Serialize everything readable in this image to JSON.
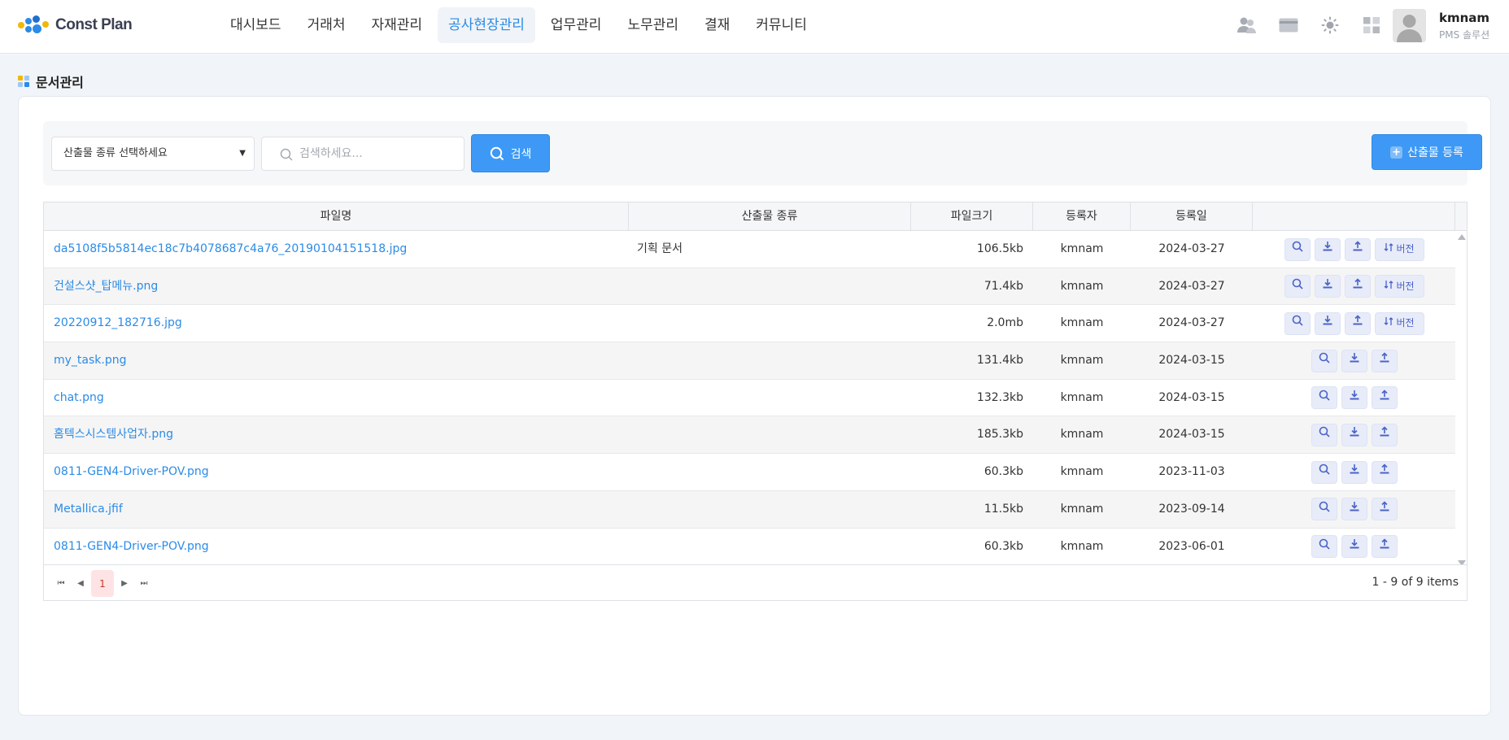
{
  "app": {
    "name": "Const Plan"
  },
  "nav": [
    {
      "label": "대시보드",
      "active": false
    },
    {
      "label": "거래처",
      "active": false
    },
    {
      "label": "자재관리",
      "active": false
    },
    {
      "label": "공사현장관리",
      "active": true
    },
    {
      "label": "업무관리",
      "active": false
    },
    {
      "label": "노무관리",
      "active": false
    },
    {
      "label": "결재",
      "active": false
    },
    {
      "label": "커뮤니티",
      "active": false
    }
  ],
  "header_icons": [
    "users-icon",
    "card-icon",
    "sun-icon",
    "grid-icon"
  ],
  "user": {
    "name": "kmnam",
    "org": "PMS 솔루션"
  },
  "page": {
    "title": "문서관리"
  },
  "filter": {
    "type_placeholder": "산출물 종류 선택하세요",
    "search_placeholder": "검색하세요...",
    "search_label": "검색",
    "register_label": "산출물 등록"
  },
  "table": {
    "columns": [
      "파일명",
      "산출물 종류",
      "파일크기",
      "등록자",
      "등록일",
      ""
    ],
    "version_label": "버전",
    "rows": [
      {
        "name": "da5108f5b5814ec18c7b4078687c4a76_20190104151518.jpg",
        "type": "기획 문서",
        "size": "106.5kb",
        "user": "kmnam",
        "date": "2024-03-27",
        "version": true
      },
      {
        "name": "건설스샷_탑메뉴.png",
        "type": "",
        "size": "71.4kb",
        "user": "kmnam",
        "date": "2024-03-27",
        "version": true
      },
      {
        "name": "20220912_182716.jpg",
        "type": "",
        "size": "2.0mb",
        "user": "kmnam",
        "date": "2024-03-27",
        "version": true
      },
      {
        "name": "my_task.png",
        "type": "",
        "size": "131.4kb",
        "user": "kmnam",
        "date": "2024-03-15",
        "version": false
      },
      {
        "name": "chat.png",
        "type": "",
        "size": "132.3kb",
        "user": "kmnam",
        "date": "2024-03-15",
        "version": false
      },
      {
        "name": "홈텍스시스템사업자.png",
        "type": "",
        "size": "185.3kb",
        "user": "kmnam",
        "date": "2024-03-15",
        "version": false
      },
      {
        "name": "0811-GEN4-Driver-POV.png",
        "type": "",
        "size": "60.3kb",
        "user": "kmnam",
        "date": "2023-11-03",
        "version": false
      },
      {
        "name": "Metallica.jfif",
        "type": "",
        "size": "11.5kb",
        "user": "kmnam",
        "date": "2023-09-14",
        "version": false
      },
      {
        "name": "0811-GEN4-Driver-POV.png",
        "type": "",
        "size": "60.3kb",
        "user": "kmnam",
        "date": "2023-06-01",
        "version": false
      }
    ]
  },
  "pager": {
    "current": "1",
    "info": "1 - 9 of 9 items"
  },
  "colors": {
    "accent": "#3d99f5",
    "link": "#2b8be6",
    "action_bg": "#e8ecf9",
    "action_icon": "#4a63c6"
  }
}
